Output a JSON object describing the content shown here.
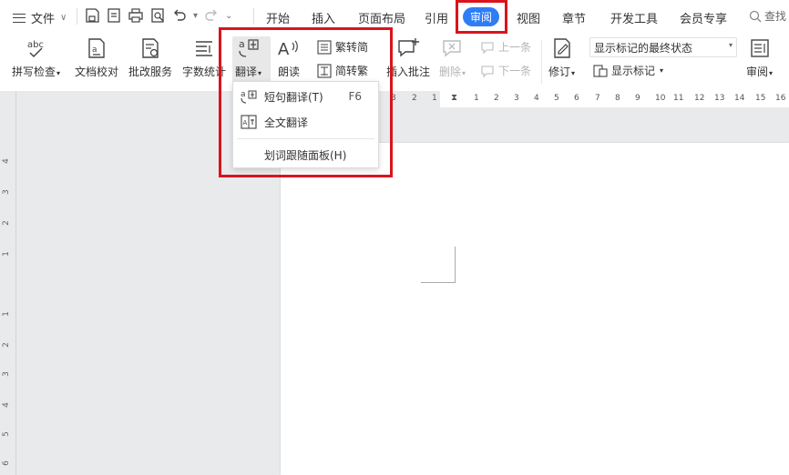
{
  "menubar": {
    "file_label": "文件",
    "tabs": [
      "开始",
      "插入",
      "页面布局",
      "引用",
      "审阅",
      "视图",
      "章节",
      "开发工具",
      "会员专享"
    ],
    "active_tab": "审阅",
    "search_label": "查找"
  },
  "ribbon": {
    "spell_check": "拼写检查",
    "doc_proofread": "文档校对",
    "correction_service": "批改服务",
    "word_count": "字数统计",
    "translate": "翻译",
    "read_aloud": "朗读",
    "trad_to_simp": "繁转简",
    "simp_to_trad": "简转繁",
    "insert_comment": "插入批注",
    "delete": "删除",
    "prev_item": "上一条",
    "next_item": "下一条",
    "revise": "修订",
    "markup_state": "显示标记的最终状态",
    "show_markup": "显示标记",
    "review": "审阅",
    "icons": {
      "abc": "abc"
    }
  },
  "translate_menu": {
    "items": [
      {
        "label": "短句翻译(T)",
        "shortcut": "F6",
        "icon": "translate-icon"
      },
      {
        "label": "全文翻译",
        "shortcut": "",
        "icon": "full-translate-icon"
      },
      {
        "label": "划词跟随面板(H)",
        "shortcut": "",
        "icon": ""
      }
    ]
  },
  "rulers": {
    "horizontal": [
      "3",
      "2",
      "1",
      "1",
      "2",
      "3",
      "4",
      "5",
      "6",
      "7",
      "8",
      "9",
      "10",
      "11",
      "12",
      "13",
      "14",
      "15",
      "16"
    ],
    "vertical": [
      "4",
      "3",
      "2",
      "1",
      "1",
      "2",
      "3",
      "4",
      "5",
      "6"
    ]
  },
  "colors": {
    "accent": "#2f7df6",
    "highlight": "#d9141c",
    "workspace": "#e9eaec"
  }
}
